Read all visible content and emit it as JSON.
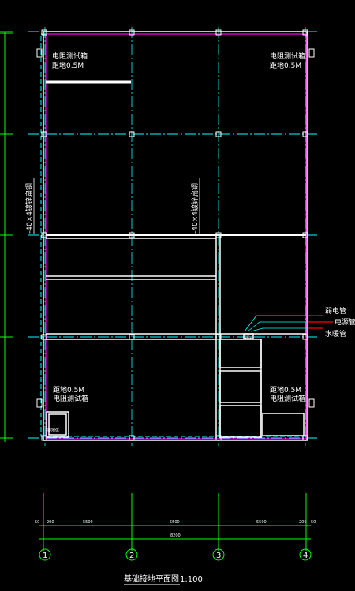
{
  "drawing": {
    "title": "基础接地平面图",
    "scale": "1:100",
    "colors": {
      "background": "#000000",
      "wall": "#ffffff",
      "gridline": "#00ffff",
      "border": "#ff00ff",
      "dimension": "#00ff00",
      "pipe": "#ff0000"
    },
    "axes": [
      "1",
      "2",
      "3",
      "4"
    ],
    "dimensions": {
      "segments": [
        "50",
        "200",
        "5500",
        "5500",
        "5500",
        "200",
        "50"
      ],
      "total": "8200"
    },
    "test_boxes": [
      {
        "line1": "电阻测试箱",
        "line2": "距地0.5M"
      },
      {
        "line1": "电阻测试箱",
        "line2": "距地0.5M"
      },
      {
        "line1": "距地0.5M",
        "line2": "电阻测试箱"
      },
      {
        "line1": "距地0.5M",
        "line2": "电阻测试箱"
      }
    ],
    "vertical_notes": [
      "-40×4镀锌扁钢",
      "-40×4镀锌扁钢"
    ],
    "pipes": [
      "弱电管",
      "电源管",
      "水暖管"
    ],
    "small_labels": [
      "接地体",
      "引入"
    ]
  }
}
